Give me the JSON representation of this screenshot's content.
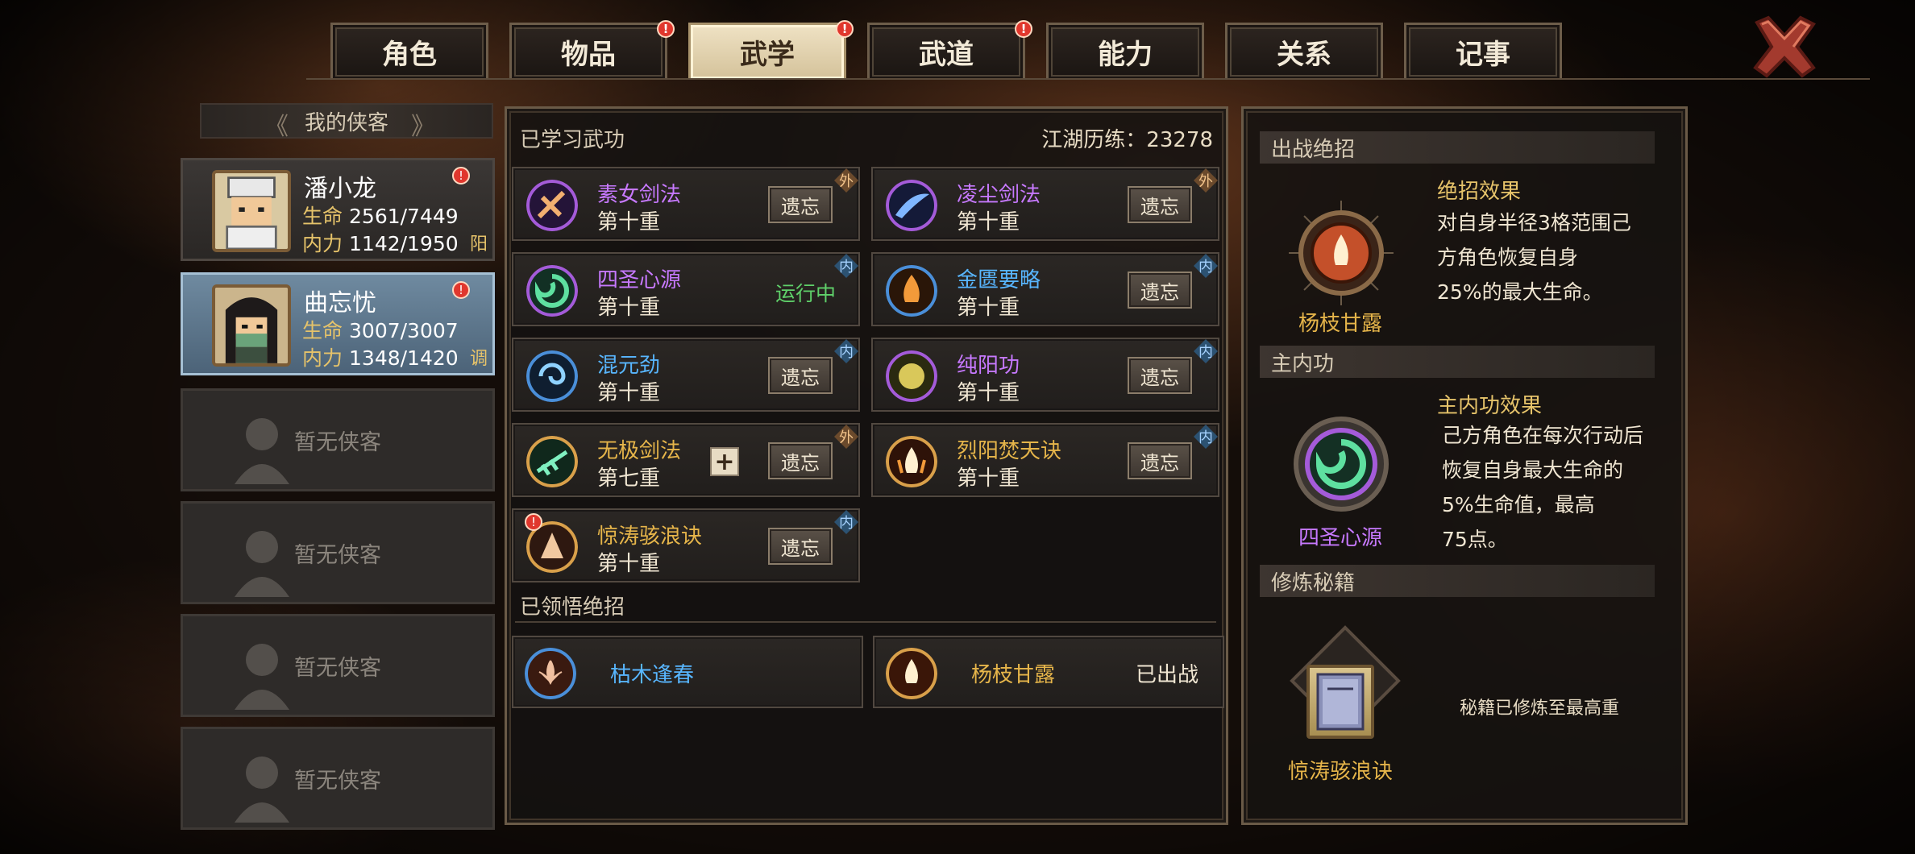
{
  "tabs": [
    {
      "label": "角色",
      "alert": false,
      "active": false
    },
    {
      "label": "物品",
      "alert": true,
      "active": false
    },
    {
      "label": "武学",
      "alert": true,
      "active": true
    },
    {
      "label": "武道",
      "alert": true,
      "active": false
    },
    {
      "label": "能力",
      "alert": false,
      "active": false
    },
    {
      "label": "关系",
      "alert": false,
      "active": false
    },
    {
      "label": "记事",
      "alert": false,
      "active": false
    }
  ],
  "alert_mark": "!",
  "left": {
    "header": "我的侠客",
    "characters": [
      {
        "name": "潘小龙",
        "hp_label": "生命",
        "hp": "2561/7449",
        "mp_label": "内力",
        "mp": "1142/1950",
        "tag": "阳"
      },
      {
        "name": "曲忘忧",
        "hp_label": "生命",
        "hp": "3007/3007",
        "mp_label": "内力",
        "mp": "1348/1420",
        "tag": "调"
      }
    ],
    "empty_label": "暂无侠客"
  },
  "middle": {
    "title": "已学习武功",
    "experience": "江湖历练：23278",
    "forget_label": "遗忘",
    "running_label": "运行中",
    "plus_label": "+",
    "skills": [
      {
        "name": "素女剑法",
        "level": "第十重",
        "kind": "外",
        "color": "purple"
      },
      {
        "name": "凌尘剑法",
        "level": "第十重",
        "kind": "外",
        "color": "purple"
      },
      {
        "name": "四圣心源",
        "level": "第十重",
        "kind": "内",
        "color": "purple",
        "running": true
      },
      {
        "name": "金匮要略",
        "level": "第十重",
        "kind": "内",
        "color": "blue"
      },
      {
        "name": "混元劲",
        "level": "第十重",
        "kind": "内",
        "color": "blue"
      },
      {
        "name": "纯阳功",
        "level": "第十重",
        "kind": "内",
        "color": "purple"
      },
      {
        "name": "无极剑法",
        "level": "第七重",
        "kind": "外",
        "color": "gold",
        "plus": true
      },
      {
        "name": "烈阳焚天诀",
        "level": "第十重",
        "kind": "内",
        "color": "gold"
      },
      {
        "name": "惊涛骇浪诀",
        "level": "第十重",
        "kind": "内",
        "color": "gold",
        "alert": true
      }
    ],
    "section2_title": "已领悟绝招",
    "ultimates": [
      {
        "name": "枯木逢春",
        "status": "",
        "color": "blue"
      },
      {
        "name": "杨枝甘露",
        "status": "已出战",
        "color": "gold"
      }
    ]
  },
  "right": {
    "section1": "出战绝招",
    "ult_name": "杨枝甘露",
    "ult_effect_title": "绝招效果",
    "ult_effect_desc": "对自身半径3格范围己\n方角色恢复自身\n25%的最大生命。",
    "section2": "主内功",
    "inner_name": "四圣心源",
    "inner_effect_title": "主内功效果",
    "inner_effect_desc": "己方角色在每次行动后\n恢复自身最大生命的\n5%生命值，最高\n75点。",
    "section3": "修炼秘籍",
    "book_name": "惊涛骇浪诀",
    "book_status": "秘籍已修炼至最高重"
  },
  "colors": {
    "purple": "#c779ff",
    "blue": "#58b6ff",
    "gold": "#e6b54a",
    "running": "#5fd06a",
    "alert": "#e0372d"
  }
}
